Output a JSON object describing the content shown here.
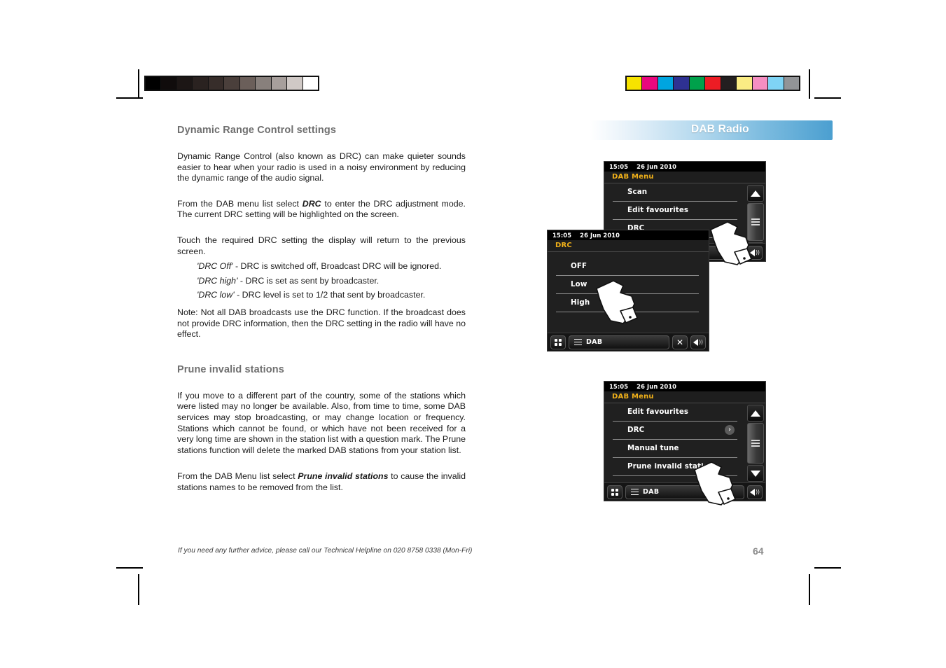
{
  "page": {
    "number": "64",
    "footer_note": "If you need any further advice, please call our Technical Helpline on 020 8758 0338 (Mon-Fri)"
  },
  "header": {
    "title": "DAB Radio",
    "gradient_start": "#ffffff",
    "gradient_end": "#4b9fd0"
  },
  "calibration": {
    "gray_swatches": [
      "#000000",
      "#100c0c",
      "#1c1615",
      "#2a2220",
      "#372d2a",
      "#4a3f3b",
      "#6b5f5a",
      "#88807c",
      "#a79f9c",
      "#d0c9c6",
      "#ffffff"
    ],
    "color_swatches": [
      "#f7e300",
      "#e9077e",
      "#00a5e0",
      "#2e3192",
      "#00a14b",
      "#ed1c24",
      "#231f20",
      "#faec84",
      "#f58fc2",
      "#7fd4f5",
      "#929497"
    ]
  },
  "article": {
    "heading_1": "Dynamic Range Control settings",
    "p1": "Dynamic Range Control (also known as DRC) can make quieter sounds easier to hear when your radio is used in a noisy environment by reducing the dynamic range of the audio signal.",
    "p2_before": "From the DAB menu list select ",
    "p2_bold": "DRC",
    "p2_after": " to enter the DRC adjustment mode. The current DRC setting will be highlighted on the screen.",
    "p3": "Touch the required DRC setting the display will return to the previous screen.",
    "bullets": [
      {
        "term": "'DRC Off'",
        "rest": " - DRC is switched off, Broadcast DRC will be ignored."
      },
      {
        "term": "'DRC high'",
        "rest": " - DRC is set as sent by broadcaster."
      },
      {
        "term": "'DRC low'",
        "rest": " - DRC level is set to 1/2 that sent by broadcaster."
      }
    ],
    "note": "Note: Not all DAB broadcasts use the DRC function. If the broadcast does not provide DRC information, then the DRC setting in the radio will have no effect.",
    "heading_2": "Prune invalid stations",
    "p4": "If you move to a different part of the country, some of the stations which were listed may no longer be available. Also, from time to time, some DAB services may stop broadcasting, or may change location or frequency. Stations which cannot be found, or which have not been received for a very long time are shown in the station list with a question mark. The Prune stations function will delete the marked DAB stations from your station list.",
    "p5_before": "From the DAB Menu list select ",
    "p5_bold": "Prune invalid stations",
    "p5_after": " to cause the invalid stations names to be removed from the list."
  },
  "screens": [
    {
      "id": "dab-menu-top",
      "time": "15:05",
      "date": "26 Jun 2010",
      "title": "DAB Menu",
      "title_color": "#f0b019",
      "items": [
        {
          "label": "Scan",
          "chevron": false
        },
        {
          "label": "Edit favourites",
          "chevron": false
        },
        {
          "label": "DRC",
          "chevron": true
        },
        {
          "label": "",
          "chevron": false
        }
      ],
      "scrollbar": {
        "up": "scroll-up-arrow",
        "grip": "scroll-grip",
        "down": "scroll-down-arrow"
      },
      "toolbar": {
        "back": "back-arrow-icon",
        "volume": "speaker-icon"
      }
    },
    {
      "id": "drc-screen",
      "time": "15:05",
      "date": "26 Jun 2010",
      "title": "DRC",
      "title_color": "#f0b019",
      "items": [
        {
          "label": "OFF",
          "chevron": false
        },
        {
          "label": "Low",
          "chevron": false
        },
        {
          "label": "High",
          "chevron": false
        }
      ],
      "toolbar": {
        "grid": "grid-icon",
        "mode_label": "DAB",
        "close": "close-icon",
        "volume": "speaker-icon"
      }
    },
    {
      "id": "dab-menu-scrolled",
      "time": "15:05",
      "date": "26 Jun 2010",
      "title": "DAB Menu",
      "title_color": "#f0b019",
      "items": [
        {
          "label": "Edit favourites",
          "chevron": false
        },
        {
          "label": "DRC",
          "chevron": true
        },
        {
          "label": "Manual tune",
          "chevron": false
        },
        {
          "label": "Prune invalid stations",
          "chevron": false
        }
      ],
      "scrollbar": {
        "up": "scroll-up-arrow",
        "grip": "scroll-grip",
        "down": "scroll-down-arrow"
      },
      "toolbar": {
        "grid": "grid-icon",
        "mode_label": "DAB",
        "volume": "speaker-icon"
      }
    }
  ]
}
